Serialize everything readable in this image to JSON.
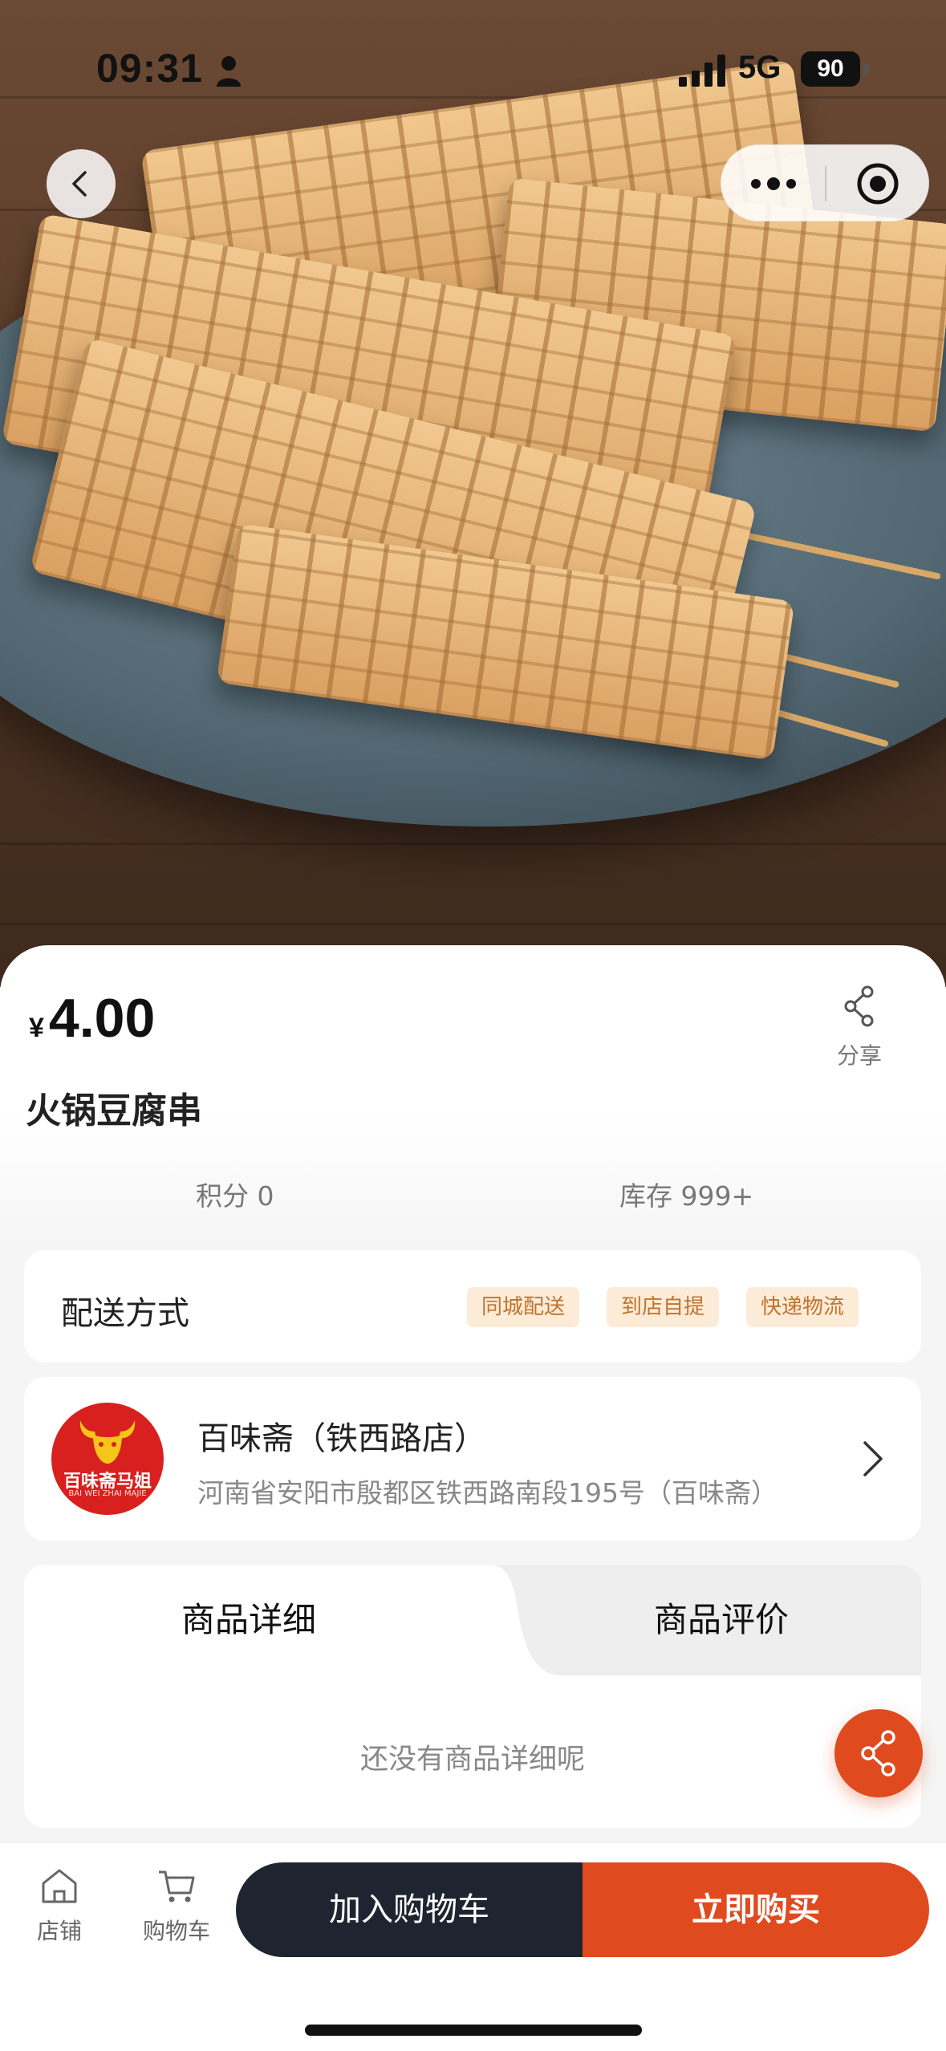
{
  "status_bar": {
    "time": "09:31",
    "network": "5G",
    "battery": "90"
  },
  "product": {
    "currency": "¥",
    "price": "4.00",
    "name": "火锅豆腐串",
    "share_label": "分享",
    "points": "积分 0",
    "stock": "库存 999+"
  },
  "delivery": {
    "title": "配送方式",
    "options": [
      "同城配送",
      "到店自提",
      "快递物流"
    ]
  },
  "store": {
    "name": "百味斋（铁西路店）",
    "address": "河南省安阳市殷都区铁西路南段195号（百味斋）",
    "logo_text": "百味斋马姐",
    "logo_subtext": "BAI WEI ZHAI MAJIE"
  },
  "tabs": {
    "details": "商品详细",
    "reviews": "商品评价",
    "empty_text": "还没有商品详细呢"
  },
  "bottom_bar": {
    "store_label": "店铺",
    "cart_label": "购物车",
    "add_to_cart": "加入购物车",
    "buy_now": "立即购买"
  },
  "colors": {
    "accent": "#e04a1f",
    "dark_button": "#1f2530",
    "tag_bg": "#fcebd7",
    "tag_text": "#c0742e"
  },
  "icons": [
    "person-icon",
    "signal-icon",
    "back-icon",
    "more-icon",
    "target-icon",
    "share-icon",
    "chevron-right-icon",
    "home-icon",
    "cart-icon"
  ]
}
